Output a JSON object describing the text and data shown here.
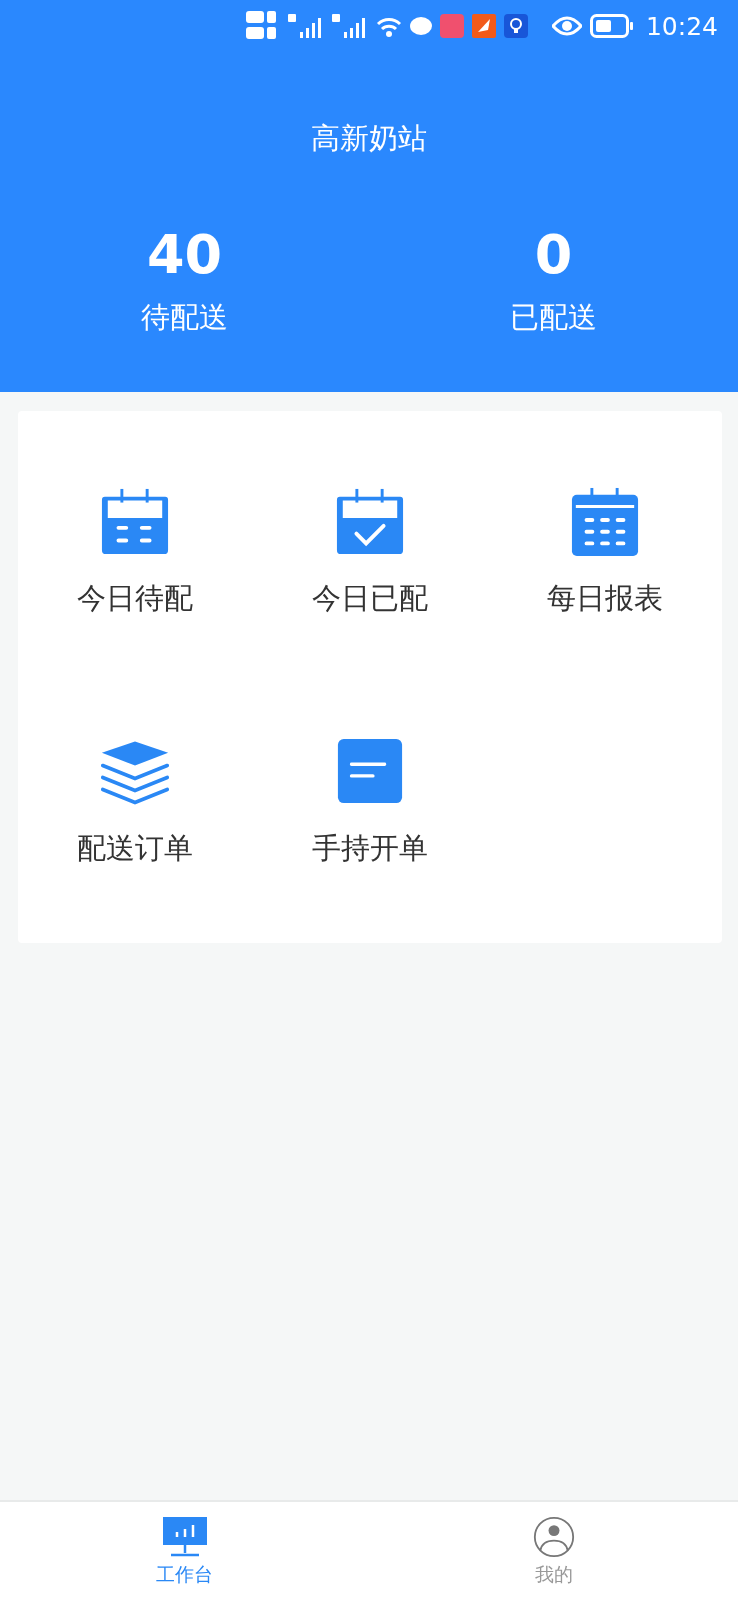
{
  "status_bar": {
    "time": "10:24"
  },
  "header": {
    "title": "高新奶站"
  },
  "stats": [
    {
      "value": "40",
      "label": "待配送"
    },
    {
      "value": "0",
      "label": "已配送"
    }
  ],
  "shortcuts": [
    {
      "kind": "calendar-lines",
      "label": "今日待配"
    },
    {
      "kind": "calendar-check",
      "label": "今日已配"
    },
    {
      "kind": "calendar-grid",
      "label": "每日报表"
    },
    {
      "kind": "layers",
      "label": "配送订单"
    },
    {
      "kind": "document",
      "label": "手持开单"
    }
  ],
  "tab_bar": [
    {
      "kind": "workbench",
      "label": "工作台",
      "selected": true
    },
    {
      "kind": "profile",
      "label": "我的",
      "selected": false
    }
  ]
}
